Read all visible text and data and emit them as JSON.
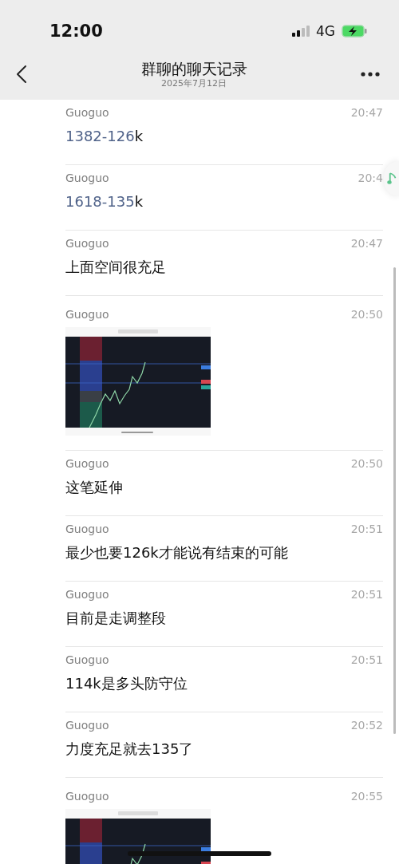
{
  "status_bar": {
    "time": "12:00",
    "network": "4G"
  },
  "header": {
    "title": "群聊的聊天记录",
    "subtitle": "2025年7月12日"
  },
  "messages": [
    {
      "kind": "text",
      "sender": "Guoguo",
      "time": "20:47",
      "link": "1382-126",
      "text": "k"
    },
    {
      "kind": "text",
      "sender": "Guoguo",
      "time": "20:4",
      "link": "1618-135",
      "text": "k"
    },
    {
      "kind": "text",
      "sender": "Guoguo",
      "time": "20:47",
      "text": "上面空间很充足"
    },
    {
      "kind": "picture",
      "sender": "Guoguo",
      "time": "20:50"
    },
    {
      "kind": "text",
      "sender": "Guoguo",
      "time": "20:50",
      "text": "这笔延伸"
    },
    {
      "kind": "text",
      "sender": "Guoguo",
      "time": "20:51",
      "text": "最少也要126k才能说有结束的可能"
    },
    {
      "kind": "text",
      "sender": "Guoguo",
      "time": "20:51",
      "text": "目前是走调整段"
    },
    {
      "kind": "text",
      "sender": "Guoguo",
      "time": "20:51",
      "text": "114k是多头防守位"
    },
    {
      "kind": "text",
      "sender": "Guoguo",
      "time": "20:52",
      "text": "力度充足就去135了"
    },
    {
      "kind": "picture",
      "sender": "Guoguo",
      "time": "20:55"
    }
  ]
}
